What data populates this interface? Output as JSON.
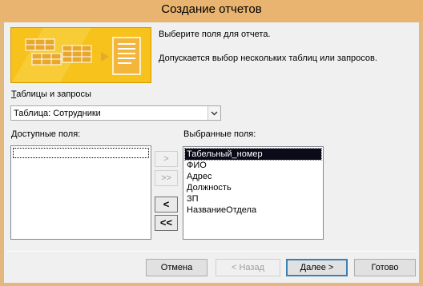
{
  "window": {
    "title": "Создание отчетов"
  },
  "intro": {
    "line1": "Выберите поля для отчета.",
    "line2": "Допускается выбор нескольких таблиц или запросов."
  },
  "tables": {
    "label_underlined": "Т",
    "label_rest": "аблицы и запросы",
    "selected": "Таблица: Сотрудники"
  },
  "available": {
    "label": "Доступные поля:",
    "items": []
  },
  "selected_fields": {
    "label": "Выбранные поля:",
    "items": [
      "Табельный_номер",
      "ФИО",
      "Адрес",
      "Должность",
      "ЗП",
      "НазваниеОтдела"
    ],
    "selected_index": 0
  },
  "move_buttons": {
    "add_one": ">",
    "add_all": ">>",
    "remove_one": "<",
    "remove_all": "<<"
  },
  "footer": {
    "cancel": "Отмена",
    "back": "< Назад",
    "next": "Далее >",
    "finish": "Готово"
  },
  "colors": {
    "title_bar": "#e8b46f",
    "banner": "#f6c21b",
    "selection": "#0a0a18",
    "default_button_border": "#3c7fb1"
  }
}
